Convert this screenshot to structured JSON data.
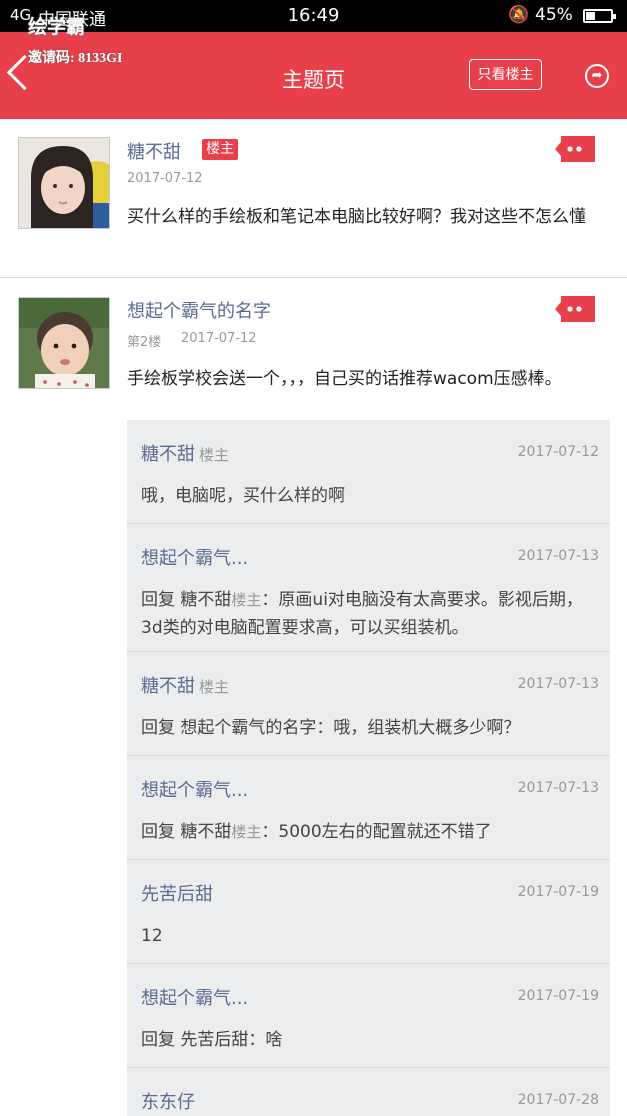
{
  "status": {
    "signal": "4G",
    "carrier": "中国联通",
    "time": "16:49",
    "battery": "45%"
  },
  "watermark": {
    "logo": "绘学霸",
    "invite": "邀请码: 8133GI"
  },
  "header": {
    "title": "主题页",
    "only_owner": "只看楼主"
  },
  "posts": [
    {
      "name": "糖不甜",
      "badge": "楼主",
      "floor": "",
      "date": "2017-07-12",
      "text": "买什么样的手绘板和笔记本电脑比较好啊？我对这些不怎么懂"
    },
    {
      "name": "想起个霸气的名字",
      "floor": "第2楼",
      "date": "2017-07-12",
      "text": "手绘板学校会送一个，，，自己买的话推荐wacom压感棒。"
    }
  ],
  "replies": [
    {
      "name": "糖不甜",
      "owner": "楼主",
      "date": "2017-07-12",
      "prefix": "",
      "target": "",
      "target_tag": "",
      "text": "哦，电脑呢，买什么样的啊"
    },
    {
      "name": "想起个霸气...",
      "owner": "",
      "date": "2017-07-13",
      "prefix": "回复 ",
      "target": "糖不甜",
      "target_tag": "楼主",
      "text": "：原画ui对电脑没有太高要求。影视后期，3d类的对电脑配置要求高，可以买组装机。"
    },
    {
      "name": "糖不甜",
      "owner": "楼主",
      "date": "2017-07-13",
      "prefix": "回复 ",
      "target": "想起个霸气的名字",
      "target_tag": "",
      "text": "：哦，组装机大概多少啊？"
    },
    {
      "name": "想起个霸气...",
      "owner": "",
      "date": "2017-07-13",
      "prefix": "回复 ",
      "target": "糖不甜",
      "target_tag": "楼主",
      "text": "：5000左右的配置就还不错了"
    },
    {
      "name": "先苦后甜",
      "owner": "",
      "date": "2017-07-19",
      "prefix": "",
      "target": "",
      "target_tag": "",
      "text": "12"
    },
    {
      "name": "想起个霸气...",
      "owner": "",
      "date": "2017-07-19",
      "prefix": "回复 ",
      "target": "先苦后甜",
      "target_tag": "",
      "text": "：啥"
    },
    {
      "name": "东东仔",
      "owner": "",
      "date": "2017-07-28",
      "prefix": "",
      "target": "",
      "target_tag": "",
      "text": ""
    }
  ]
}
